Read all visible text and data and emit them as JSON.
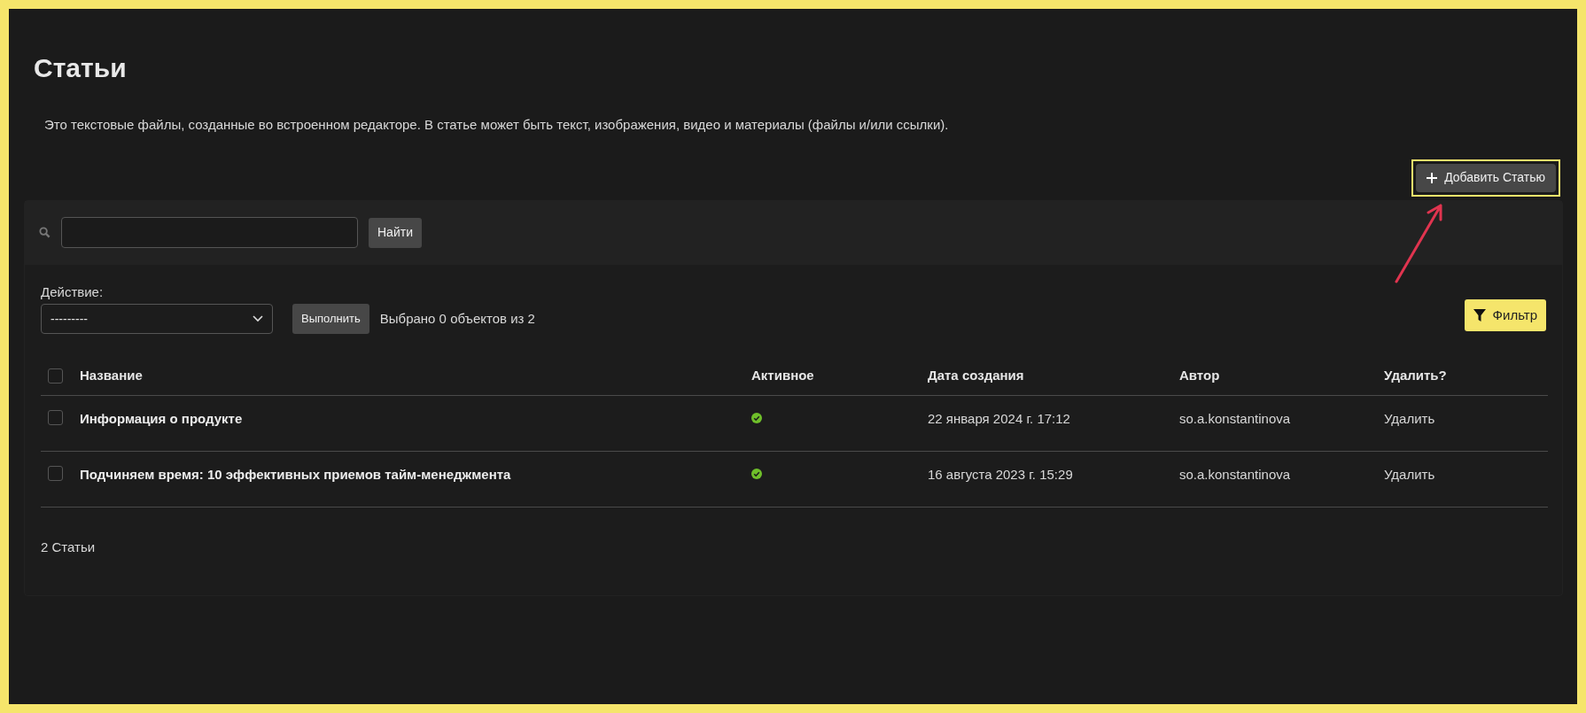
{
  "title": "Статьи",
  "description": "Это текстовые файлы, созданные во встроенном редакторе. В статье может быть текст, изображения, видео и материалы (файлы и/или ссылки).",
  "add_button": {
    "label": "Добавить Статью",
    "highlighted": true
  },
  "search": {
    "button": "Найти"
  },
  "actions": {
    "label": "Действие:",
    "select_value": "---------",
    "run_button": "Выполнить",
    "selection_info": "Выбрано 0 объектов из 2"
  },
  "filter_button": "Фильтр",
  "table": {
    "select_all_checked": false,
    "columns": [
      "Название",
      "Активное",
      "Дата создания",
      "Автор",
      "Удалить?"
    ],
    "rows": [
      {
        "checked": false,
        "name": "Информация о продукте",
        "active": true,
        "created": "22 января 2024 г. 17:12",
        "author": "so.a.konstantinova",
        "delete": "Удалить"
      },
      {
        "checked": false,
        "name": "Подчиняем время: 10 эффективных приемов тайм-менеджмента",
        "active": true,
        "created": "16 августа 2023 г. 15:29",
        "author": "so.a.konstantinova",
        "delete": "Удалить"
      }
    ]
  },
  "footer": "2 Статьи"
}
